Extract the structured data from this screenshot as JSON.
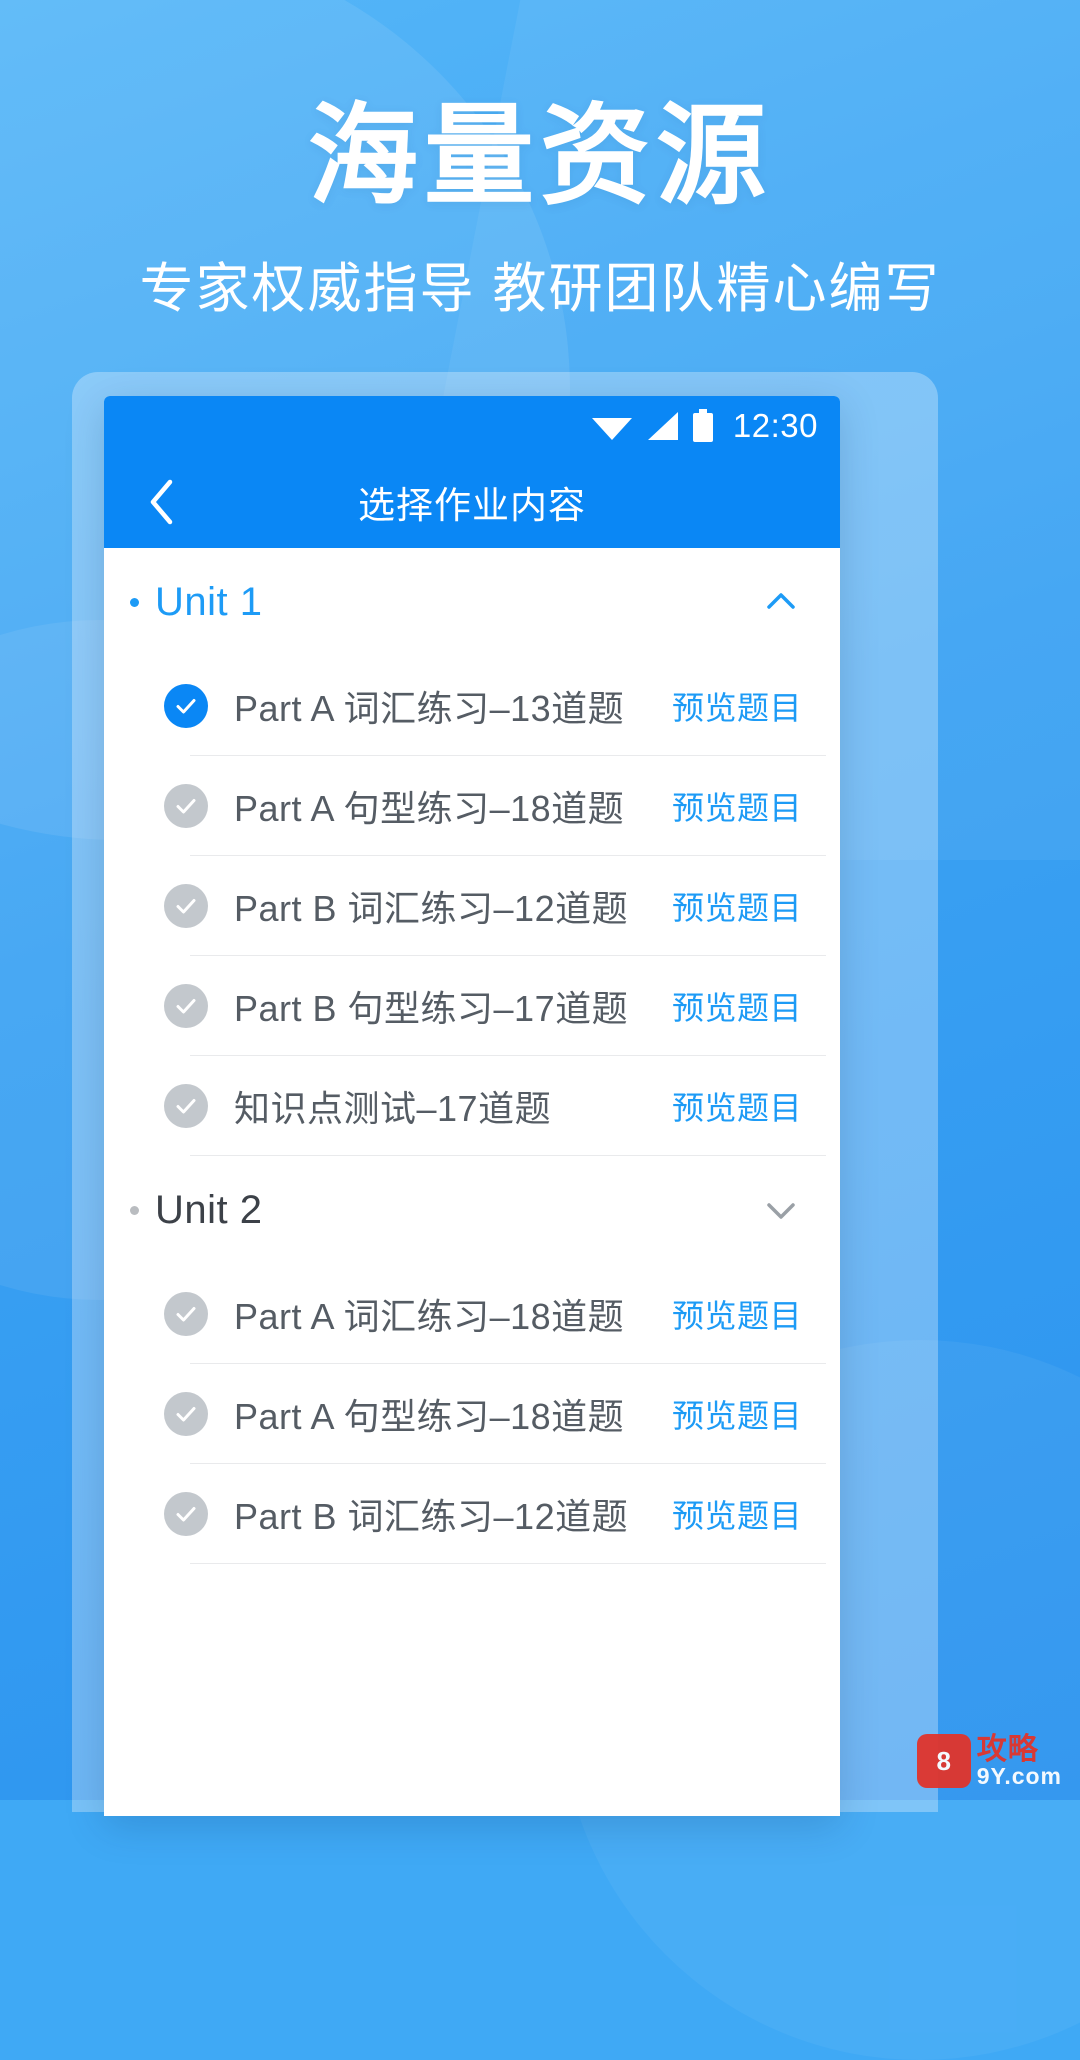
{
  "promo": {
    "title": "海量资源",
    "subtitle": "专家权威指导 教研团队精心编写"
  },
  "status_bar": {
    "wifi_icon": "wifi-icon",
    "signal_icon": "signal-icon",
    "battery_icon": "battery-icon",
    "time": "12:30"
  },
  "title_bar": {
    "back_icon": "back-chevron-icon",
    "title": "选择作业内容"
  },
  "colors": {
    "brand_blue": "#0a87f5",
    "link_blue": "#1d9bf6",
    "check_on": "#0a87f5",
    "check_off": "#c3c8cd",
    "text_gray": "#555c64"
  },
  "units": [
    {
      "label": "Unit 1",
      "expanded": true,
      "chevron_icon": "chevron-up-icon",
      "items": [
        {
          "label": "Part A 词汇练习–13道题",
          "checked": true,
          "preview": "预览题目"
        },
        {
          "label": "Part A 句型练习–18道题",
          "checked": false,
          "preview": "预览题目"
        },
        {
          "label": "Part B 词汇练习–12道题",
          "checked": false,
          "preview": "预览题目"
        },
        {
          "label": "Part B 句型练习–17道题",
          "checked": false,
          "preview": "预览题目"
        },
        {
          "label": "知识点测试–17道题",
          "checked": false,
          "preview": "预览题目"
        }
      ]
    },
    {
      "label": "Unit 2",
      "expanded": false,
      "chevron_icon": "chevron-down-icon",
      "items": [
        {
          "label": "Part A 词汇练习–18道题",
          "checked": false,
          "preview": "预览题目"
        },
        {
          "label": "Part A 句型练习–18道题",
          "checked": false,
          "preview": "预览题目"
        },
        {
          "label": "Part B 词汇练习–12道题",
          "checked": false,
          "preview": "预览题目"
        }
      ]
    }
  ],
  "watermark": {
    "badge": "8",
    "line1": "攻略",
    "line2": "9Y.com"
  }
}
